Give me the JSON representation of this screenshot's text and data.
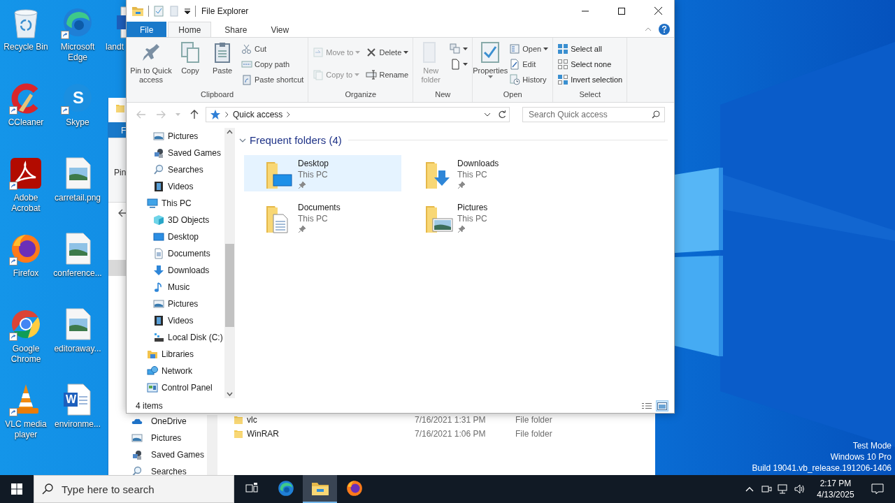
{
  "desktop": {
    "icons": [
      {
        "label": "Recycle Bin",
        "kind": "recycle-bin",
        "shortcut": false
      },
      {
        "label": "CCleaner",
        "kind": "ccleaner",
        "shortcut": true
      },
      {
        "label": "Adobe Acrobat",
        "kind": "acrobat",
        "shortcut": true
      },
      {
        "label": "Firefox",
        "kind": "firefox",
        "shortcut": true
      },
      {
        "label": "Google Chrome",
        "kind": "chrome",
        "shortcut": true
      },
      {
        "label": "VLC media player",
        "kind": "vlc",
        "shortcut": true
      },
      {
        "label": "Microsoft Edge",
        "kind": "edge",
        "shortcut": true
      },
      {
        "label": "Skype",
        "kind": "skype",
        "shortcut": true,
        "logo_letter": "S"
      },
      {
        "label": "carretail.png",
        "kind": "image-file",
        "shortcut": false
      },
      {
        "label": "conference...",
        "kind": "image-file",
        "shortcut": false
      },
      {
        "label": "editoraway...",
        "kind": "image-file",
        "shortcut": false
      },
      {
        "label": "environme...",
        "kind": "word-file",
        "shortcut": false,
        "logo_letter": "W"
      },
      {
        "label": "landt",
        "kind": "word-file",
        "shortcut": false
      }
    ],
    "test_mode_notice": [
      "Test Mode",
      "Windows 10 Pro",
      "Build 19041.vb_release.191206-1406"
    ]
  },
  "background_window": {
    "file_tab": "F",
    "ribbon_label": "Pin",
    "nav_items": [
      {
        "label": "OneDrive",
        "kind": "onedrive"
      },
      {
        "label": "Pictures",
        "kind": "pictures"
      },
      {
        "label": "Saved Games",
        "kind": "saved-games"
      },
      {
        "label": "Searches",
        "kind": "searches"
      }
    ],
    "files": [
      {
        "name": "vlc",
        "date": "7/16/2021 1:31 PM",
        "type": "File folder"
      },
      {
        "name": "WinRAR",
        "date": "7/16/2021 1:06 PM",
        "type": "File folder"
      }
    ]
  },
  "explorer": {
    "title": "File Explorer",
    "tabs": [
      {
        "label": "File",
        "kind": "menu",
        "selected": false
      },
      {
        "label": "Home",
        "kind": "tab",
        "selected": true
      },
      {
        "label": "Share",
        "kind": "tab",
        "selected": false
      },
      {
        "label": "View",
        "kind": "tab",
        "selected": false
      }
    ],
    "ribbon": [
      {
        "label": "Clipboard",
        "large": [
          {
            "label": "Pin to Quick access",
            "kind": "pin",
            "disabled": false
          },
          {
            "label": "Copy",
            "kind": "copy",
            "disabled": false
          },
          {
            "label": "Paste",
            "kind": "paste",
            "disabled": false
          }
        ],
        "columns": [
          [
            {
              "label": "Cut",
              "kind": "cut",
              "disabled": false
            },
            {
              "label": "Copy path",
              "kind": "copy-path",
              "disabled": false
            },
            {
              "label": "Paste shortcut",
              "kind": "paste-shortcut",
              "disabled": false
            }
          ]
        ]
      },
      {
        "label": "Organize",
        "columns": [
          [
            {
              "label": "Move to",
              "kind": "move-to",
              "disabled": true,
              "dropdown": true
            },
            {
              "label": "Copy to",
              "kind": "copy-to",
              "disabled": true,
              "dropdown": true
            }
          ],
          [
            {
              "label": "Delete",
              "kind": "delete",
              "disabled": false,
              "dropdown": true
            },
            {
              "label": "Rename",
              "kind": "rename",
              "disabled": false
            }
          ]
        ]
      },
      {
        "label": "New",
        "large": [
          {
            "label": "New folder",
            "kind": "new-folder",
            "disabled": true
          }
        ],
        "columns": [
          [
            {
              "kind": "new-item",
              "disabled": false,
              "dropdown": true
            },
            {
              "kind": "easy-access",
              "disabled": false,
              "dropdown": true
            }
          ]
        ]
      },
      {
        "label": "Open",
        "large": [
          {
            "label": "Properties",
            "kind": "properties",
            "disabled": false,
            "dropdown": true
          }
        ],
        "columns": [
          [
            {
              "label": "Open",
              "kind": "open",
              "disabled": false,
              "dropdown": true
            },
            {
              "label": "Edit",
              "kind": "edit",
              "disabled": false
            },
            {
              "label": "History",
              "kind": "history",
              "disabled": false
            }
          ]
        ]
      },
      {
        "label": "Select",
        "columns": [
          [
            {
              "label": "Select all",
              "kind": "select-all",
              "disabled": false
            },
            {
              "label": "Select none",
              "kind": "select-none",
              "disabled": false
            },
            {
              "label": "Invert selection",
              "kind": "invert-selection",
              "disabled": false
            }
          ]
        ]
      }
    ],
    "address": {
      "path": "Quick access",
      "search_placeholder": "Search Quick access"
    },
    "nav_tree": [
      {
        "children": [
          {
            "label": "Pictures",
            "kind": "pictures"
          },
          {
            "label": "Saved Games",
            "kind": "saved-games"
          },
          {
            "label": "Searches",
            "kind": "searches"
          },
          {
            "label": "Videos",
            "kind": "videos"
          }
        ]
      },
      {
        "label": "This PC",
        "kind": "pc",
        "children": [
          {
            "label": "3D Objects",
            "kind": "cube"
          },
          {
            "label": "Desktop",
            "kind": "desktop"
          },
          {
            "label": "Documents",
            "kind": "documents"
          },
          {
            "label": "Downloads",
            "kind": "downloads"
          },
          {
            "label": "Music",
            "kind": "music"
          },
          {
            "label": "Pictures",
            "kind": "pictures"
          },
          {
            "label": "Videos",
            "kind": "videos"
          },
          {
            "label": "Local Disk (C:)",
            "kind": "local-disk"
          }
        ]
      },
      {
        "label": "Libraries",
        "kind": "libraries"
      },
      {
        "label": "Network",
        "kind": "network"
      },
      {
        "label": "Control Panel",
        "kind": "control-panel"
      }
    ],
    "groups": [
      {
        "title": "Frequent folders (4)",
        "expanded": true,
        "items": [
          {
            "name": "Desktop",
            "location": "This PC",
            "kind": "desktop",
            "pinned": true,
            "selected": true
          },
          {
            "name": "Downloads",
            "location": "This PC",
            "kind": "downloads",
            "pinned": true,
            "selected": false
          },
          {
            "name": "Documents",
            "location": "This PC",
            "kind": "documents",
            "pinned": true,
            "selected": false
          },
          {
            "name": "Pictures",
            "location": "This PC",
            "kind": "pictures",
            "pinned": true,
            "selected": false
          }
        ]
      }
    ],
    "status_bar": {
      "item_count": "4 items",
      "views": [
        {
          "kind": "details",
          "selected": false
        },
        {
          "kind": "large-icons",
          "selected": true
        }
      ]
    }
  },
  "taskbar": {
    "search_placeholder": "Type here to search",
    "apps": [
      {
        "kind": "task-view",
        "active": false
      },
      {
        "kind": "edge",
        "active": false
      },
      {
        "kind": "explorer",
        "active": true
      },
      {
        "kind": "firefox",
        "active": false
      }
    ],
    "time": "2:17 PM",
    "date": "4/13/2025"
  }
}
